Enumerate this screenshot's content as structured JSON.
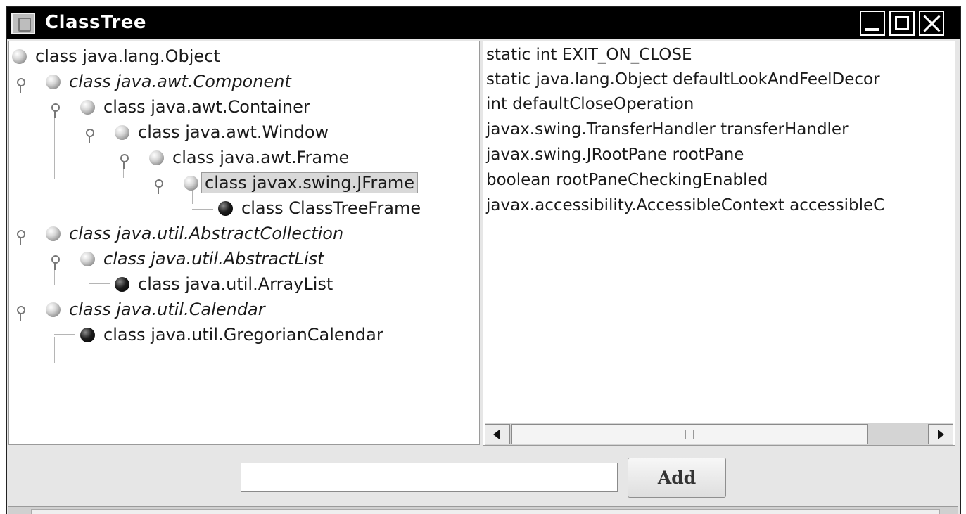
{
  "window": {
    "title": "ClassTree",
    "controls": [
      "minimize",
      "maximize",
      "close"
    ]
  },
  "tree": {
    "nodes": [
      {
        "label": "class java.lang.Object",
        "italic": false,
        "leaf": false,
        "selected": false
      },
      {
        "label": "class java.awt.Component",
        "italic": true,
        "leaf": false,
        "selected": false
      },
      {
        "label": "class java.awt.Container",
        "italic": false,
        "leaf": false,
        "selected": false
      },
      {
        "label": "class java.awt.Window",
        "italic": false,
        "leaf": false,
        "selected": false
      },
      {
        "label": "class java.awt.Frame",
        "italic": false,
        "leaf": false,
        "selected": false
      },
      {
        "label": "class javax.swing.JFrame",
        "italic": false,
        "leaf": false,
        "selected": true
      },
      {
        "label": "class ClassTreeFrame",
        "italic": false,
        "leaf": true,
        "selected": false
      },
      {
        "label": "class java.util.AbstractCollection",
        "italic": true,
        "leaf": false,
        "selected": false
      },
      {
        "label": "class java.util.AbstractList",
        "italic": true,
        "leaf": false,
        "selected": false
      },
      {
        "label": "class java.util.ArrayList",
        "italic": false,
        "leaf": true,
        "selected": false
      },
      {
        "label": "class java.util.Calendar",
        "italic": true,
        "leaf": false,
        "selected": false
      },
      {
        "label": "class java.util.GregorianCalendar",
        "italic": false,
        "leaf": true,
        "selected": false
      }
    ]
  },
  "fields": {
    "items": [
      "static int EXIT_ON_CLOSE",
      "static java.lang.Object defaultLookAndFeelDecor",
      "int defaultCloseOperation",
      "javax.swing.TransferHandler transferHandler",
      "javax.swing.JRootPane rootPane",
      "boolean rootPaneCheckingEnabled",
      "javax.accessibility.AccessibleContext accessibleC"
    ]
  },
  "bottom": {
    "input_value": "",
    "add_label": "Add"
  },
  "colors": {
    "titlebar": "#000000",
    "selection": "#d9d9d9",
    "panel": "#e6e6e6"
  }
}
